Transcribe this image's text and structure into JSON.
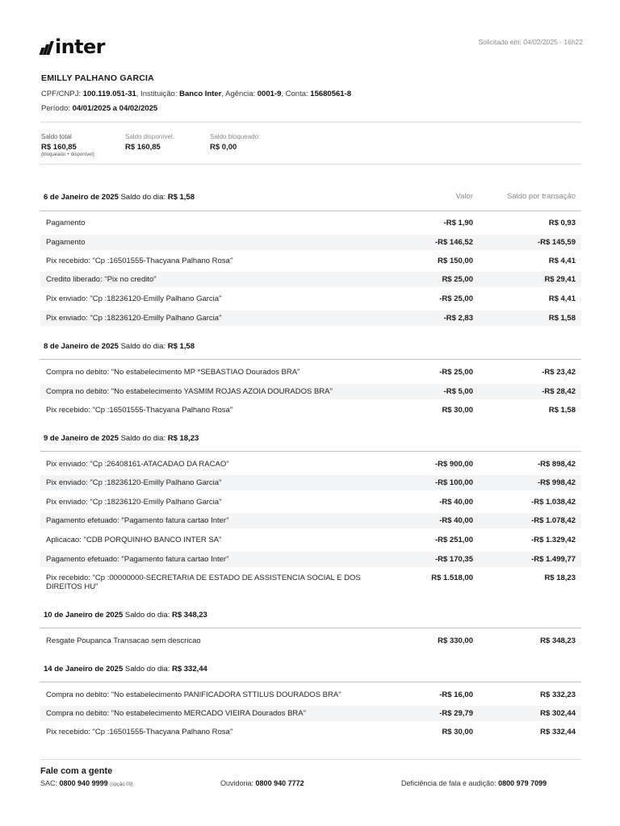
{
  "brand": {
    "logo_text": "inter",
    "logo_icon": "inter-stripes-logo"
  },
  "requested_at": "Solicitado em: 04/02/2025 - 16h22",
  "holder_name": "EMILLY PALHANO GARCIA",
  "account": {
    "doc_label": "CPF/CNPJ:",
    "doc_value": "100.119.051-31",
    "institution_label": ", Instituição:",
    "institution_value": "Banco Inter",
    "agency_label": ", Agência:",
    "agency_value": "0001-9",
    "account_label": ", Conta:",
    "account_value": "15680561-8"
  },
  "period": {
    "label": "Período:",
    "value": "04/01/2025 a 04/02/2025"
  },
  "balances": {
    "total_label": "Saldo total",
    "total_value": "R$ 160,85",
    "total_note": "(bloqueado + disponível)",
    "available_label": "Saldo disponível:",
    "available_value": "R$ 160,85",
    "blocked_label": "Saldo bloqueado:",
    "blocked_value": "R$ 0,00"
  },
  "columns": {
    "value": "Valor",
    "balance": "Saldo por transação"
  },
  "days": [
    {
      "date": "6 de Janeiro de 2025",
      "balance_label": "Saldo do dia:",
      "balance": "R$ 1,58",
      "rows": [
        {
          "desc": "Pagamento",
          "value": "-R$ 1,90",
          "balance": "R$ 0,93"
        },
        {
          "desc": "Pagamento",
          "value": "-R$ 146,52",
          "balance": "-R$ 145,59"
        },
        {
          "desc": "Pix recebido: \"Cp :16501555-Thacyana Palhano Rosa\"",
          "value": "R$ 150,00",
          "balance": "R$ 4,41"
        },
        {
          "desc": "Credito liberado: \"Pix no credito\"",
          "value": "R$ 25,00",
          "balance": "R$ 29,41"
        },
        {
          "desc": "Pix enviado: \"Cp :18236120-Emilly Palhano Garcia\"",
          "value": "-R$ 25,00",
          "balance": "R$ 4,41"
        },
        {
          "desc": "Pix enviado: \"Cp :18236120-Emilly Palhano Garcia\"",
          "value": "-R$ 2,83",
          "balance": "R$ 1,58"
        }
      ]
    },
    {
      "date": "8 de Janeiro de 2025",
      "balance_label": "Saldo do dia:",
      "balance": "R$ 1,58",
      "rows": [
        {
          "desc": "Compra no debito: \"No estabelecimento MP *SEBASTIAO Dourados BRA\"",
          "value": "-R$ 25,00",
          "balance": "-R$ 23,42"
        },
        {
          "desc": "Compra no debito: \"No estabelecimento YASMIM ROJAS AZOIA DOURADOS BRA\"",
          "value": "-R$ 5,00",
          "balance": "-R$ 28,42"
        },
        {
          "desc": "Pix recebido: \"Cp :16501555-Thacyana Palhano Rosa\"",
          "value": "R$ 30,00",
          "balance": "R$ 1,58"
        }
      ]
    },
    {
      "date": "9 de Janeiro de 2025",
      "balance_label": "Saldo do dia:",
      "balance": "R$ 18,23",
      "rows": [
        {
          "desc": "Pix enviado: \"Cp :26408161-ATACADAO DA RACAO\"",
          "value": "-R$ 900,00",
          "balance": "-R$ 898,42"
        },
        {
          "desc": "Pix enviado: \"Cp :18236120-Emilly Palhano Garcia\"",
          "value": "-R$ 100,00",
          "balance": "-R$ 998,42"
        },
        {
          "desc": "Pix enviado: \"Cp :18236120-Emilly Palhano Garcia\"",
          "value": "-R$ 40,00",
          "balance": "-R$ 1.038,42"
        },
        {
          "desc": "Pagamento efetuado: \"Pagamento fatura cartao Inter\"",
          "value": "-R$ 40,00",
          "balance": "-R$ 1.078,42"
        },
        {
          "desc": "Aplicacao: \"CDB PORQUINHO BANCO INTER SA\"",
          "value": "-R$ 251,00",
          "balance": "-R$ 1.329,42"
        },
        {
          "desc": "Pagamento efetuado: \"Pagamento fatura cartao Inter\"",
          "value": "-R$ 170,35",
          "balance": "-R$ 1.499,77"
        },
        {
          "desc": "Pix recebido: \"Cp :00000000-SECRETARIA DE ESTADO DE ASSISTENCIA SOCIAL E DOS DIREITOS HU\"",
          "value": "R$ 1.518,00",
          "balance": "R$ 18,23"
        }
      ]
    },
    {
      "date": "10 de Janeiro de 2025",
      "balance_label": "Saldo do dia:",
      "balance": "R$ 348,23",
      "rows": [
        {
          "desc": "Resgate Poupanca Transacao sem descricao",
          "value": "R$ 330,00",
          "balance": "R$ 348,23"
        }
      ]
    },
    {
      "date": "14 de Janeiro de 2025",
      "balance_label": "Saldo do dia:",
      "balance": "R$ 332,44",
      "rows": [
        {
          "desc": "Compra no debito: \"No estabelecimento PANIFICADORA STTILUS DOURADOS BRA\"",
          "value": "-R$ 16,00",
          "balance": "R$ 332,23"
        },
        {
          "desc": "Compra no debito: \"No estabelecimento MERCADO VIEIRA Dourados BRA\"",
          "value": "-R$ 29,79",
          "balance": "R$ 302,44"
        },
        {
          "desc": "Pix recebido: \"Cp :16501555-Thacyana Palhano Rosa\"",
          "value": "R$ 30,00",
          "balance": "R$ 332,44"
        }
      ]
    }
  ],
  "footer": {
    "title": "Fale com a gente",
    "sac_label": "SAC:",
    "sac_number": "0800 940 9999",
    "sac_note": "(opção 09)",
    "ombudsman_label": "Ouvidoria:",
    "ombudsman_number": "0800 940 7772",
    "accessibility_label": "Deficiência de fala e audição:",
    "accessibility_number": "0800 979 7099"
  }
}
